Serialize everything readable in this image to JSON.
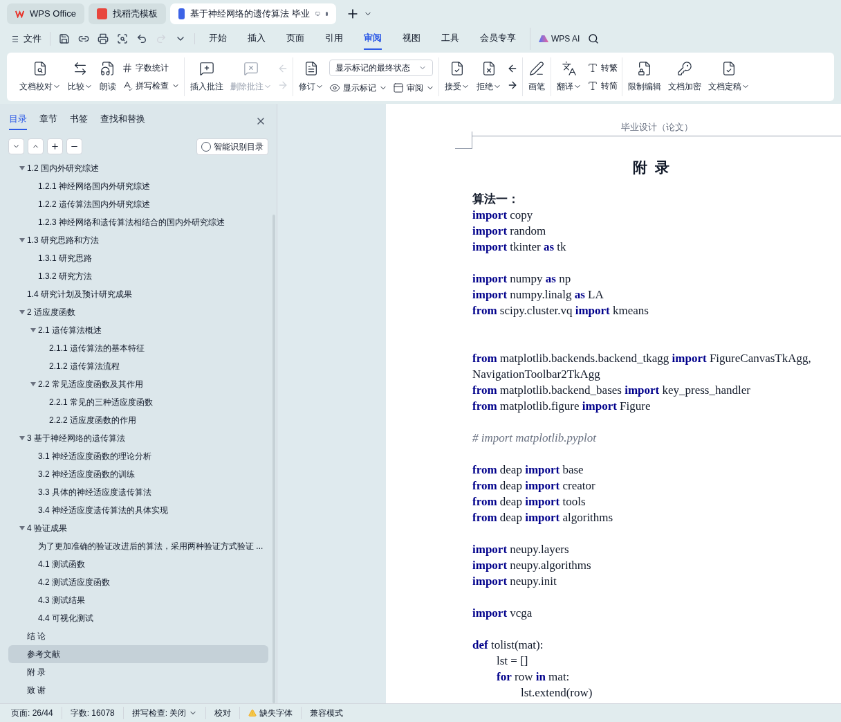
{
  "window_tabs": [
    {
      "label": "WPS Office",
      "kind": "home",
      "selected": false
    },
    {
      "label": "找稻壳模板",
      "kind": "template",
      "selected": false
    },
    {
      "label": "基于神经网络的遗传算法 毕业",
      "kind": "document",
      "selected": true
    }
  ],
  "file_menu": "文件",
  "menu_tabs": [
    {
      "label": "开始",
      "selected": false
    },
    {
      "label": "插入",
      "selected": false
    },
    {
      "label": "页面",
      "selected": false
    },
    {
      "label": "引用",
      "selected": false
    },
    {
      "label": "审阅",
      "selected": true
    },
    {
      "label": "视图",
      "selected": false
    },
    {
      "label": "工具",
      "selected": false
    },
    {
      "label": "会员专享",
      "selected": false
    }
  ],
  "ai_button": "WPS AI",
  "ribbon": [
    [
      {
        "kind": "large",
        "label": "文档校对",
        "dropdown": true,
        "disabled": false
      },
      {
        "kind": "large",
        "label": "比较",
        "dropdown": true,
        "disabled": false
      },
      {
        "kind": "large",
        "label": "朗读",
        "dropdown": false,
        "disabled": false
      },
      {
        "kind": "stack",
        "items": [
          {
            "label": "字数统计",
            "dropdown": false
          },
          {
            "label": "拼写检查",
            "dropdown": true
          }
        ]
      }
    ],
    [
      {
        "kind": "large",
        "label": "插入批注",
        "dropdown": false,
        "disabled": false
      },
      {
        "kind": "large",
        "label": "删除批注",
        "dropdown": true,
        "disabled": true
      },
      {
        "kind": "nav",
        "disabled": true
      }
    ],
    [
      {
        "kind": "large",
        "label": "修订",
        "dropdown": true,
        "disabled": false
      },
      {
        "kind": "select",
        "value": "显示标记的最终状态",
        "items": [
          {
            "label": "显示标记",
            "dropdown": true
          },
          {
            "label": "审阅",
            "dropdown": true
          }
        ]
      }
    ],
    [
      {
        "kind": "large",
        "label": "接受",
        "dropdown": true,
        "disabled": false
      },
      {
        "kind": "large",
        "label": "拒绝",
        "dropdown": true,
        "disabled": false
      },
      {
        "kind": "nav",
        "disabled": false
      }
    ],
    [
      {
        "kind": "large",
        "label": "画笔",
        "dropdown": false,
        "disabled": false
      }
    ],
    [
      {
        "kind": "large",
        "label": "翻译",
        "dropdown": true,
        "disabled": false
      },
      {
        "kind": "stack",
        "items": [
          {
            "label": "转繁",
            "dropdown": false
          },
          {
            "label": "转简",
            "dropdown": false
          }
        ]
      }
    ],
    [
      {
        "kind": "large",
        "label": "限制编辑",
        "dropdown": false,
        "disabled": false
      },
      {
        "kind": "large",
        "label": "文档加密",
        "dropdown": false,
        "disabled": false
      },
      {
        "kind": "large",
        "label": "文档定稿",
        "dropdown": true,
        "disabled": false
      }
    ]
  ],
  "sidebar": {
    "tabs": [
      {
        "label": "目录",
        "selected": true
      },
      {
        "label": "章节",
        "selected": false
      },
      {
        "label": "书签",
        "selected": false
      },
      {
        "label": "查找和替换",
        "selected": false
      }
    ],
    "smart_button": "智能识别目录",
    "outline": [
      {
        "children": [
          {
            "label": "1.2  国内外研究综述",
            "selected": false,
            "expanded": true,
            "children": [
              {
                "label": "1.2.1  神经网络国内外研究综述",
                "selected": false
              },
              {
                "label": "1.2.2  遗传算法国内外研究综述",
                "selected": false
              },
              {
                "label": "1.2.3  神经网络和遗传算法相结合的国内外研究综述",
                "selected": false
              }
            ]
          },
          {
            "label": "1.3  研究思路和方法",
            "selected": false,
            "expanded": true,
            "children": [
              {
                "label": "1.3.1  研究思路",
                "selected": false
              },
              {
                "label": "1.3.2  研究方法",
                "selected": false
              }
            ]
          },
          {
            "label": "1.4 研究计划及预计研究成果",
            "selected": false
          }
        ]
      },
      {
        "label": "2  适应度函数",
        "selected": false,
        "expanded": true,
        "children": [
          {
            "label": "2.1  遗传算法概述",
            "selected": false,
            "expanded": true,
            "children": [
              {
                "label": "2.1.1  遗传算法的基本特征",
                "selected": false
              },
              {
                "label": "2.1.2  遗传算法流程",
                "selected": false
              }
            ]
          },
          {
            "label": "2.2  常见适应度函数及其作用",
            "selected": false,
            "expanded": true,
            "children": [
              {
                "label": "2.2.1  常见的三种适应度函数",
                "selected": false
              },
              {
                "label": "2.2.2  适应度函数的作用",
                "selected": false
              }
            ]
          }
        ]
      },
      {
        "label": "3  基于神经网络的遗传算法",
        "selected": false,
        "expanded": true,
        "children": [
          {
            "label": "3.1  神经适应度函数的理论分析",
            "selected": false
          },
          {
            "label": "3.2  神经适应度函数的训练",
            "selected": false
          },
          {
            "label": "3.3  具体的神经适应度遗传算法",
            "selected": false
          },
          {
            "label": "3.4  神经适应度遗传算法的具体实现",
            "selected": false
          }
        ]
      },
      {
        "label": "4  验证成果",
        "selected": false,
        "expanded": true,
        "children": [
          {
            "label": "为了更加准确的验证改进后的算法，采用两种验证方式验证 ...",
            "selected": false
          },
          {
            "label": "4.1  测试函数",
            "selected": false
          },
          {
            "label": "4.2  测试适应度函数",
            "selected": false
          },
          {
            "label": "4.3  测试结果",
            "selected": false
          },
          {
            "label": "4.4  可视化测试",
            "selected": false
          }
        ]
      },
      {
        "label": "结  论",
        "selected": false
      },
      {
        "label": "参考文献",
        "selected": true
      },
      {
        "label": "附  录",
        "selected": false
      },
      {
        "label": "致  谢",
        "selected": false
      }
    ]
  },
  "document": {
    "header": "毕业设计（论文）",
    "title": "附  录",
    "blocks": [
      {
        "wide_gap": false,
        "lines": [
          {
            "kind": "heading",
            "text": "算法一："
          },
          {
            "kind": "code",
            "text": "**import** copy"
          },
          {
            "kind": "code",
            "text": "**import** random"
          },
          {
            "kind": "code",
            "text": "**import** tkinter **as** tk"
          }
        ]
      },
      {
        "wide_gap": false,
        "lines": [
          {
            "kind": "code",
            "text": "**import** numpy **as** np"
          },
          {
            "kind": "code",
            "text": "**import** numpy.linalg **as** LA"
          },
          {
            "kind": "code",
            "text": "**from** scipy.cluster.vq **import** kmeans"
          }
        ]
      },
      {
        "wide_gap": true,
        "lines": [
          {
            "kind": "code",
            "text": "**from** matplotlib.backends.backend_tkagg **import** FigureCanvasTkAgg, NavigationToolbar2TkAgg"
          },
          {
            "kind": "code",
            "text": "**from** matplotlib.backend_bases **import** key_press_handler"
          },
          {
            "kind": "code",
            "text": "**from** matplotlib.figure **import** Figure"
          }
        ]
      },
      {
        "wide_gap": false,
        "lines": [
          {
            "kind": "comment",
            "text": "# import matplotlib.pyplot"
          }
        ]
      },
      {
        "wide_gap": false,
        "lines": [
          {
            "kind": "code",
            "text": "**from** deap **import** base"
          },
          {
            "kind": "code",
            "text": "**from** deap **import** creator"
          },
          {
            "kind": "code",
            "text": "**from** deap **import** tools"
          },
          {
            "kind": "code",
            "text": "**from** deap **import** algorithms"
          }
        ]
      },
      {
        "wide_gap": false,
        "lines": [
          {
            "kind": "code",
            "text": "**import** neupy.layers"
          },
          {
            "kind": "code",
            "text": "**import** neupy.algorithms"
          },
          {
            "kind": "code",
            "text": "**import** neupy.init"
          }
        ]
      },
      {
        "wide_gap": false,
        "lines": [
          {
            "kind": "code",
            "text": "**import** vcga"
          }
        ]
      },
      {
        "wide_gap": false,
        "lines": [
          {
            "kind": "code",
            "text": "**def** tolist(mat):",
            "children": [
              {
                "kind": "code",
                "text": "lst = []"
              },
              {
                "kind": "code",
                "text": "**for** row **in** mat:",
                "children": [
                  {
                    "kind": "code",
                    "text": "lst.extend(row)"
                  }
                ]
              }
            ]
          }
        ]
      }
    ]
  },
  "status_bar": [
    {
      "kind": "text",
      "label": "页面: 26/44"
    },
    {
      "kind": "text",
      "label": "字数: 16078"
    },
    {
      "kind": "dropdown",
      "label": "拼写检查: 关闭"
    },
    {
      "kind": "text",
      "label": "校对"
    },
    {
      "kind": "warning",
      "label": "缺失字体"
    },
    {
      "kind": "text",
      "label": "兼容模式"
    }
  ]
}
